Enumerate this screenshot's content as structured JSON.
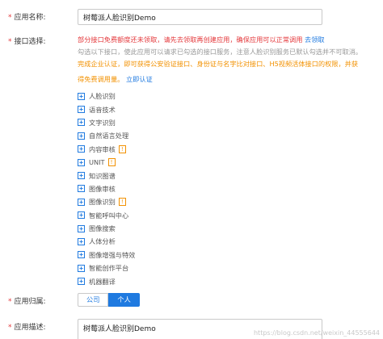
{
  "form": {
    "app_name": {
      "label": "应用名称:",
      "value": "树莓派人脸识别Demo"
    },
    "api_select": {
      "label": "接口选择:",
      "notice_red": "部分接口免费额度还未领取，请先去领取再创建应用，确保应用可以正常调用",
      "notice_red_link": "去领取",
      "notice_gray_1": "勾选以下接口，使此应用可以请求已勾选的接口服务，注意人脸识别服务已默认勾选并不可取消。",
      "notice_orange_1": "完成企业认证，即可获得公安验证接口、身份证与名字比对接口、H5视频活体接口的权限，并获",
      "notice_orange_2": "得免费调用量。",
      "notice_orange_link": "立即认证",
      "items": [
        {
          "label": "人脸识别",
          "icon": "plus-square-icon",
          "warn": false
        },
        {
          "label": "语音技术",
          "icon": "plus-square-icon",
          "warn": false
        },
        {
          "label": "文字识别",
          "icon": "plus-square-icon",
          "warn": false
        },
        {
          "label": "自然语言处理",
          "icon": "plus-square-icon",
          "warn": false
        },
        {
          "label": "内容审核",
          "icon": "plus-square-icon",
          "warn": true
        },
        {
          "label": "UNIT",
          "icon": "plus-square-icon",
          "warn": true
        },
        {
          "label": "知识图谱",
          "icon": "plus-square-icon",
          "warn": false
        },
        {
          "label": "图像审核",
          "icon": "plus-square-icon",
          "warn": false
        },
        {
          "label": "图像识别",
          "icon": "plus-square-icon",
          "warn": true
        },
        {
          "label": "智能呼叫中心",
          "icon": "plus-square-icon",
          "warn": false
        },
        {
          "label": "图像搜索",
          "icon": "plus-square-icon",
          "warn": false
        },
        {
          "label": "人体分析",
          "icon": "plus-square-icon",
          "warn": false
        },
        {
          "label": "图像增强与特效",
          "icon": "plus-square-icon",
          "warn": false
        },
        {
          "label": "智能创作平台",
          "icon": "plus-square-icon",
          "warn": false
        },
        {
          "label": "机器翻译",
          "icon": "plus-square-icon",
          "warn": false
        }
      ],
      "warn_symbol": "!"
    },
    "app_owner": {
      "label": "应用归属:",
      "options": [
        "公司",
        "个人"
      ],
      "selected": "个人"
    },
    "app_desc": {
      "label": "应用描述:",
      "value": "树莓派人脸识别Demo"
    }
  },
  "watermark": "https://blog.csdn.net/weixin_44555644",
  "colors": {
    "accent": "#1f7ae0",
    "required": "#e4393c",
    "warning": "#f29100"
  }
}
